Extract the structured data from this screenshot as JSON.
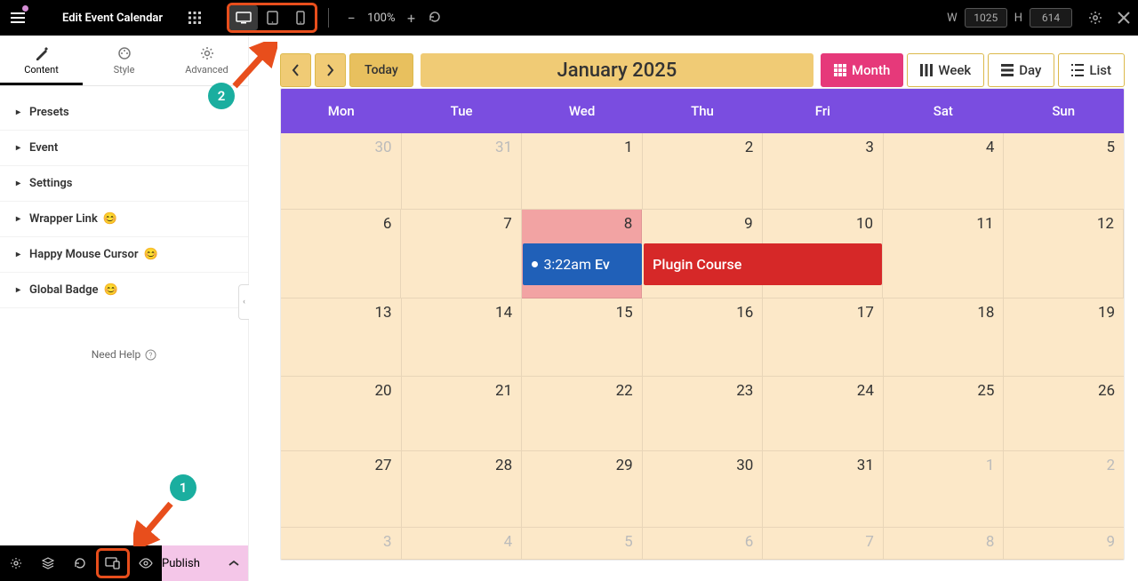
{
  "topbar": {
    "title": "Edit Event Calendar",
    "zoom": "100%",
    "dims": {
      "w_label": "W",
      "w_value": "1025",
      "h_label": "H",
      "h_value": "614"
    }
  },
  "tabs": {
    "content": "Content",
    "style": "Style",
    "advanced": "Advanced"
  },
  "accordion": {
    "presets": "Presets",
    "event": "Event",
    "settings": "Settings",
    "wrapper": "Wrapper Link",
    "cursor": "Happy Mouse Cursor",
    "badge": "Global Badge"
  },
  "needHelp": "Need Help",
  "publish": "Publish",
  "calendar": {
    "today": "Today",
    "title": "January 2025",
    "views": {
      "month": "Month",
      "week": "Week",
      "day": "Day",
      "list": "List"
    },
    "dayHeaders": [
      "Mon",
      "Tue",
      "Wed",
      "Thu",
      "Fri",
      "Sat",
      "Sun"
    ],
    "rows": [
      [
        {
          "d": "30",
          "o": true
        },
        {
          "d": "31",
          "o": true
        },
        {
          "d": "1"
        },
        {
          "d": "2"
        },
        {
          "d": "3"
        },
        {
          "d": "4"
        },
        {
          "d": "5"
        }
      ],
      [
        {
          "d": "6"
        },
        {
          "d": "7"
        },
        {
          "d": "8",
          "hl": true
        },
        {
          "d": "9"
        },
        {
          "d": "10"
        },
        {
          "d": "11"
        },
        {
          "d": "12"
        }
      ],
      [
        {
          "d": "13"
        },
        {
          "d": "14"
        },
        {
          "d": "15"
        },
        {
          "d": "16"
        },
        {
          "d": "17"
        },
        {
          "d": "18"
        },
        {
          "d": "19"
        }
      ],
      [
        {
          "d": "20"
        },
        {
          "d": "21"
        },
        {
          "d": "22"
        },
        {
          "d": "23"
        },
        {
          "d": "24"
        },
        {
          "d": "25"
        },
        {
          "d": "26"
        }
      ],
      [
        {
          "d": "27"
        },
        {
          "d": "28"
        },
        {
          "d": "29"
        },
        {
          "d": "30"
        },
        {
          "d": "31"
        },
        {
          "d": "1",
          "o": true
        },
        {
          "d": "2",
          "o": true
        }
      ],
      [
        {
          "d": "3",
          "o": true
        },
        {
          "d": "4",
          "o": true
        },
        {
          "d": "5",
          "o": true
        },
        {
          "d": "6",
          "o": true
        },
        {
          "d": "7",
          "o": true
        },
        {
          "d": "8",
          "o": true
        },
        {
          "d": "9",
          "o": true
        }
      ]
    ],
    "events": {
      "row": 1,
      "items": [
        {
          "col": 2,
          "span": 1,
          "color": "blue",
          "time": "3:22am",
          "name": "Ev",
          "bullet": true
        },
        {
          "col": 3,
          "span": 2,
          "color": "red",
          "name": "Plugin Course"
        }
      ]
    }
  },
  "annotations": {
    "b1": "1",
    "b2": "2"
  }
}
